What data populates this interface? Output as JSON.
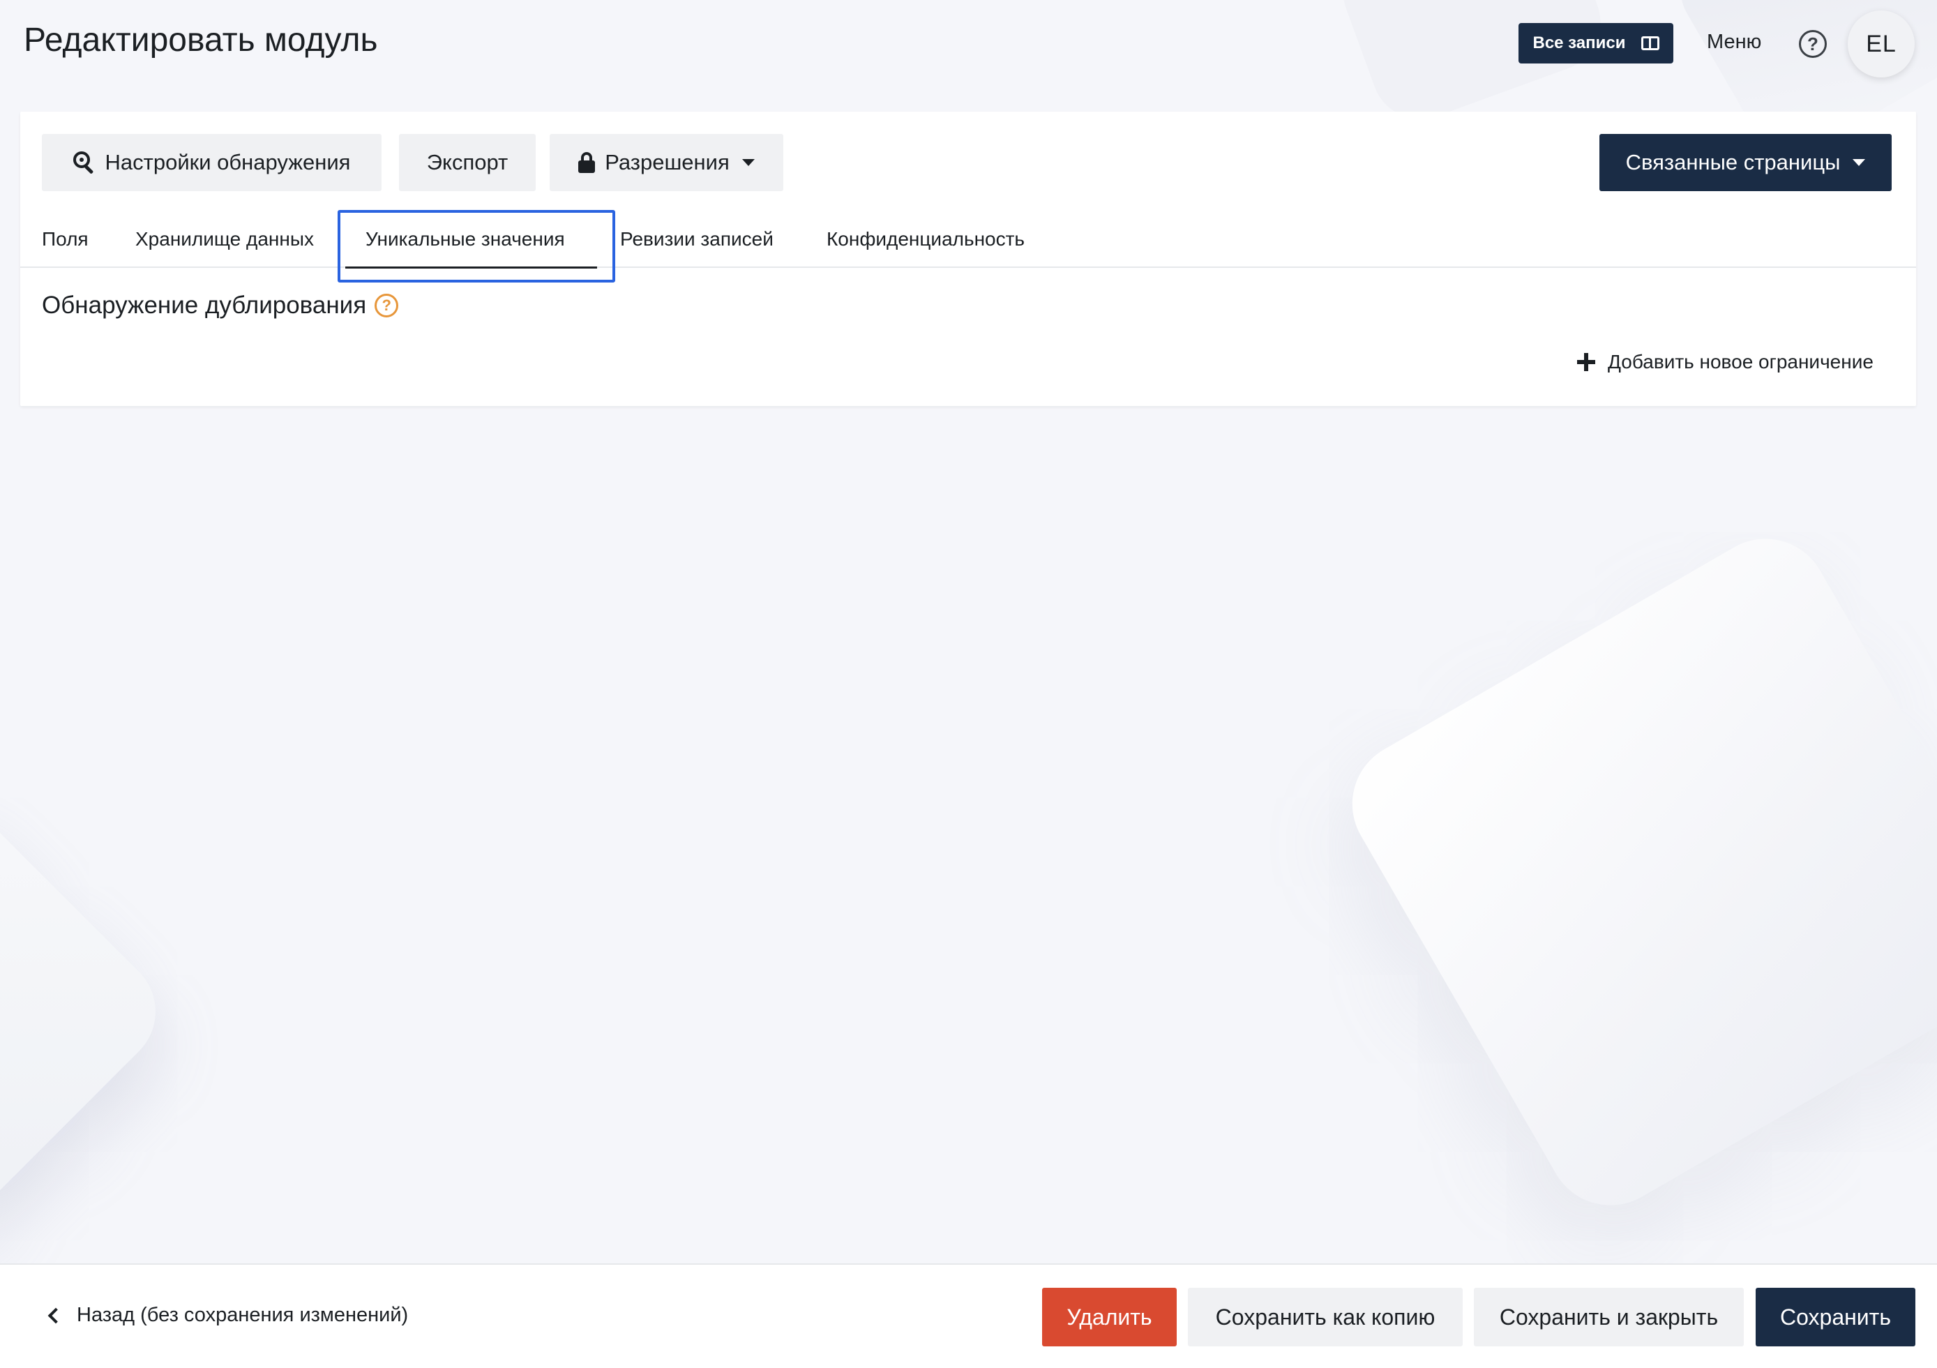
{
  "header": {
    "title": "Редактировать модуль",
    "all_records_label": "Все записи",
    "menu_label": "Меню",
    "help_glyph": "?",
    "avatar_initials": "EL"
  },
  "toolbar": {
    "discovery_label": "Настройки обнаружения",
    "export_label": "Экспорт",
    "permissions_label": "Разрешения",
    "related_pages_label": "Связанные страницы"
  },
  "tabs": [
    {
      "label": "Поля",
      "active": false
    },
    {
      "label": "Хранилище данных",
      "active": false
    },
    {
      "label": "Уникальные значения",
      "active": true
    },
    {
      "label": "Ревизии записей",
      "active": false
    },
    {
      "label": "Конфиденциальность",
      "active": false
    }
  ],
  "section": {
    "title": "Обнаружение дублирования",
    "info_glyph": "?",
    "add_constraint_label": "Добавить новое ограничение"
  },
  "footer": {
    "back_label": "Назад (без сохранения изменений)",
    "delete_label": "Удалить",
    "save_copy_label": "Сохранить как копию",
    "save_close_label": "Сохранить и закрыть",
    "save_label": "Сохранить"
  },
  "icons": {
    "all_records": "columns-icon",
    "discovery": "search-icon",
    "permissions": "lock-icon",
    "help": "help-circle-icon",
    "info": "info-circle-icon",
    "add": "plus-icon",
    "back": "chevron-left-icon"
  },
  "colors": {
    "primary": "#1a2c45",
    "danger": "#d94a30",
    "focus_outline": "#2a63e0",
    "info_accent": "#e7963a",
    "background": "#f5f6fa"
  }
}
